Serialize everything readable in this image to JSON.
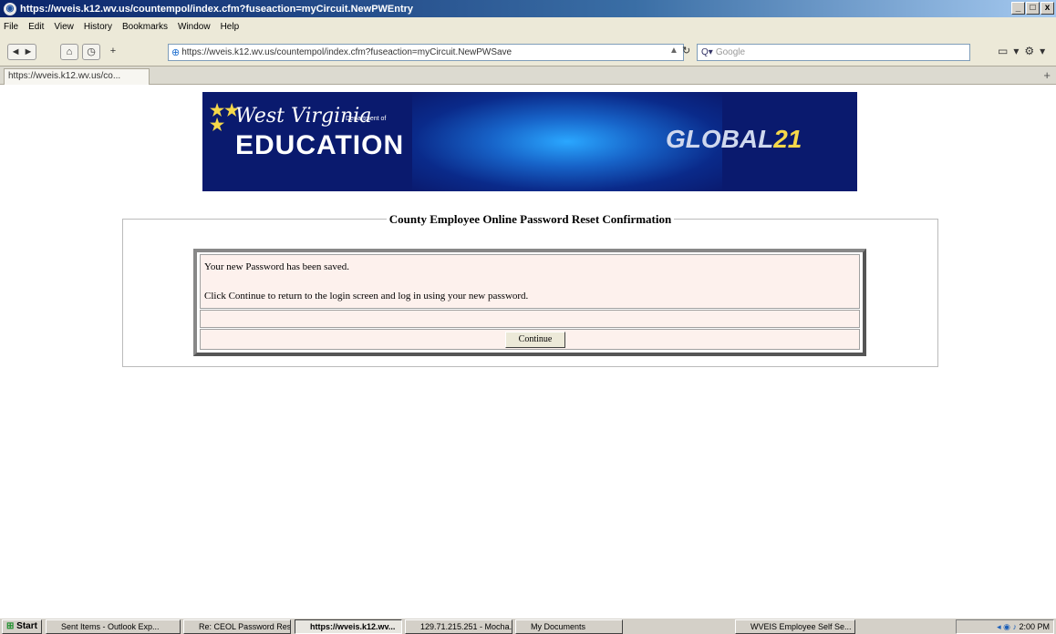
{
  "window": {
    "title": "https://wveis.k12.wv.us/countempol/index.cfm?fuseaction=myCircuit.NewPWEntry",
    "controls": [
      "_",
      "□",
      "x"
    ]
  },
  "menu": [
    "File",
    "Edit",
    "View",
    "History",
    "Bookmarks",
    "Window",
    "Help"
  ],
  "nav": {
    "url": "https://wveis.k12.wv.us/countempol/index.cfm?fuseaction=myCircuit.NewPWSave",
    "search_placeholder": "Google"
  },
  "tab": {
    "label": "https://wveis.k12.wv.us/co..."
  },
  "banner": {
    "line1": "West Virginia",
    "subline": "Department of",
    "line2": "EDUCATION",
    "global_prefix": "GLOBAL",
    "global_num": "21"
  },
  "content": {
    "heading": "County Employee Online Password Reset Confirmation",
    "message1": "Your new Password has been saved.",
    "message2": "Click Continue to return to the login screen and log in using your new password.",
    "continue_label": "Continue"
  },
  "taskbar": {
    "start": "Start",
    "items": [
      "Sent Items - Outlook Exp...",
      "Re: CEOL Password Res...",
      "https://wveis.k12.wv...",
      "129.71.215.251 - Mocha...",
      "My Documents",
      "WVEIS Employee Self Se..."
    ],
    "clock": "2:00 PM"
  }
}
